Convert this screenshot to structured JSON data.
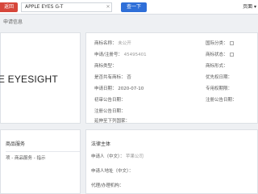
{
  "toolbar": {
    "back_label": "返回",
    "search_value": "APPLE EYES G-T",
    "clear_icon": "close-icon",
    "go_label": "查一下",
    "right_label": "页面 ▾"
  },
  "breadcrumb": "申请信息",
  "mark": {
    "text": "LE EYESIGHT"
  },
  "details": [
    {
      "label": "商标名称：",
      "value": "未公开"
    },
    {
      "label": "申请/注册号：",
      "value": "45495401"
    },
    {
      "label": "商标类型：",
      "value": "—"
    },
    {
      "label": "是否共有商标：",
      "value": "否"
    },
    {
      "label": "申请日期：",
      "value": "2020-07-10"
    },
    {
      "label": "初审公告日期：",
      "value": "—"
    },
    {
      "label": "注册公告日期：",
      "value": "—"
    },
    {
      "label": "延伸至下列国家：",
      "value": ""
    }
  ],
  "details_right": [
    {
      "label": "国际分类：",
      "value": ""
    },
    {
      "label": "商标状态：",
      "value": ""
    },
    {
      "label": "商标形式：",
      "value": ""
    },
    {
      "label": "优先权日期：",
      "value": ""
    },
    {
      "label": "专用权期限：",
      "value": ""
    },
    {
      "label": "注册公告日期：",
      "value": ""
    }
  ],
  "goods": {
    "title": "商品服务",
    "item": "项 - 商品服务 - 指示"
  },
  "legal": {
    "title": "法律主体",
    "rows": [
      {
        "label": "申请人（中文）：",
        "value": "苹果公司"
      },
      {
        "label": "申请人地址（中文）：",
        "value": ""
      },
      {
        "label": "代理/办理机构：",
        "value": ""
      }
    ]
  }
}
